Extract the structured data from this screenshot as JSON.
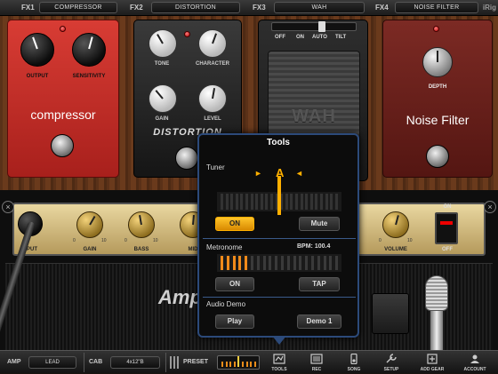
{
  "fx_slots": [
    {
      "label": "FX1",
      "name": "COMPRESSOR"
    },
    {
      "label": "FX2",
      "name": "DISTORTION"
    },
    {
      "label": "FX3",
      "name": "WAH"
    },
    {
      "label": "FX4",
      "name": "NOISE FILTER"
    }
  ],
  "brand": "iRig",
  "compressor": {
    "title": "compressor",
    "knob1": "OUTPUT",
    "knob2": "SENSITIVITY"
  },
  "distortion": {
    "knob1": "TONE",
    "knob2": "CHARACTER",
    "knob3": "GAIN",
    "knob4": "LEVEL",
    "logo": "DISTORTION"
  },
  "wah": {
    "sw_off": "OFF",
    "sw_on": "ON",
    "sw_auto": "AUTO",
    "sw_tilt": "TILT",
    "word": "WAH"
  },
  "noise_filter": {
    "knob": "DEPTH",
    "title": "Noise Filter"
  },
  "amp": {
    "input_label": "INPUT",
    "knobs": [
      "GAIN",
      "BASS",
      "MID",
      "VOLUME"
    ],
    "scale_min": "0",
    "scale_max": "10",
    "on_label": "ON",
    "off_label": "OFF",
    "logo": "AmpliTube"
  },
  "tools": {
    "title": "Tools",
    "tuner_label": "Tuner",
    "note": "A",
    "tuner_on": "ON",
    "tuner_mute": "Mute",
    "metronome_label": "Metronome",
    "bpm": "BPM: 100.4",
    "metro_on": "ON",
    "metro_tap": "TAP",
    "audio_demo_label": "Audio Demo",
    "play": "Play",
    "demo": "Demo 1"
  },
  "toolbar": {
    "amp_label": "AMP",
    "amp_value": "LEAD",
    "cab_label": "CAB",
    "cab_value": "4x12\"B",
    "preset_label": "PRESET",
    "buttons": [
      "TOOLS",
      "REC",
      "SONG",
      "SETUP",
      "ADD GEAR",
      "ACCOUNT"
    ]
  },
  "colors": {
    "accent": "#ffb000",
    "popover_border": "#2c4a7a",
    "comp_red": "#d83c34"
  }
}
